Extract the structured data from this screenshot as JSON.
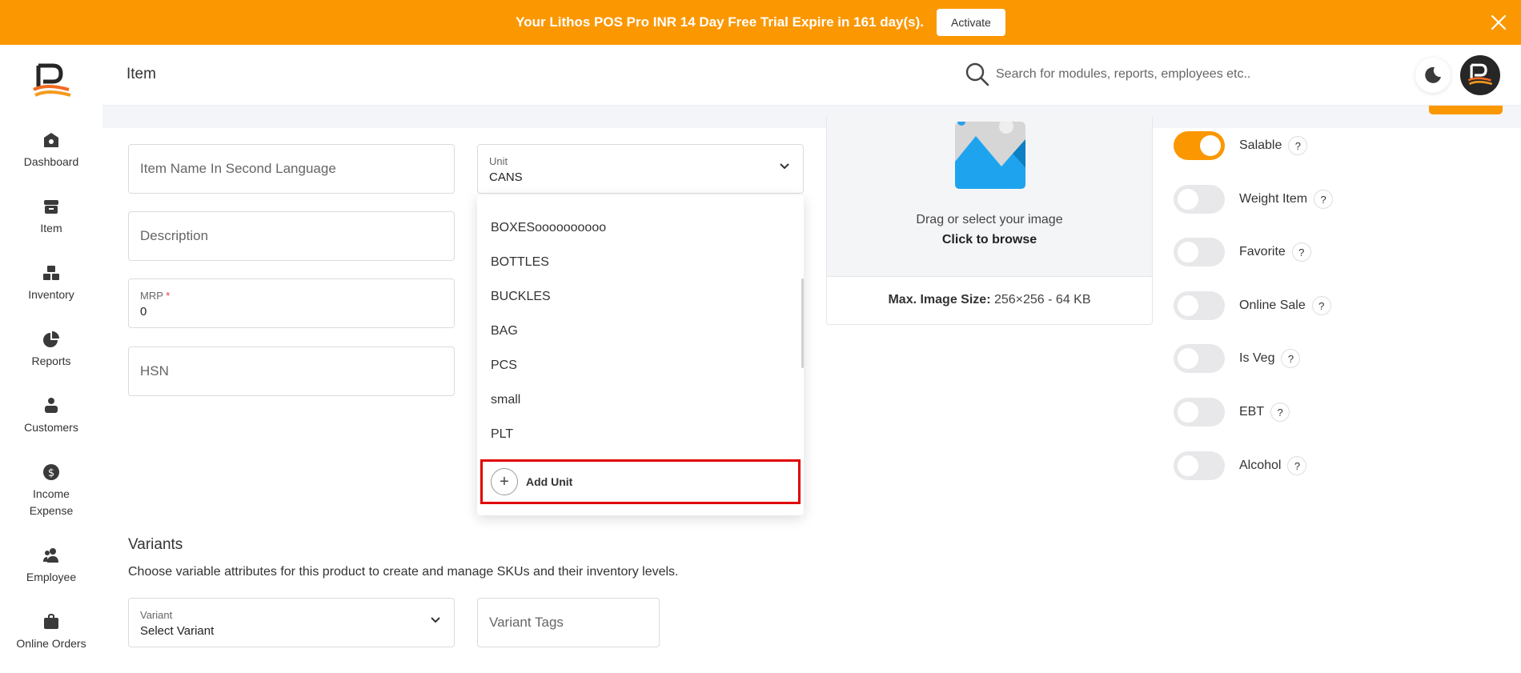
{
  "banner": {
    "text": "Your Lithos POS Pro INR 14 Day Free Trial Expire in 161 day(s).",
    "activate_label": "Activate"
  },
  "sidebar": {
    "items": [
      {
        "label": "Dashboard",
        "icon": "home-icon"
      },
      {
        "label": "Item",
        "icon": "archive-icon"
      },
      {
        "label": "Inventory",
        "icon": "boxes-icon"
      },
      {
        "label": "Reports",
        "icon": "pie-chart-icon"
      },
      {
        "label": "Customers",
        "icon": "customers-icon"
      },
      {
        "label": "Income Expense",
        "icon": "dollar-icon"
      },
      {
        "label": "Employee",
        "icon": "users-icon"
      },
      {
        "label": "Online Orders",
        "icon": "bag-icon"
      }
    ]
  },
  "header": {
    "title": "Item",
    "search_placeholder": "Search for modules, reports, employees etc.."
  },
  "form": {
    "second_language_placeholder": "Item Name In Second Language",
    "description_placeholder": "Description",
    "mrp_label": "MRP",
    "mrp_required": "*",
    "mrp_value": "0",
    "hsn_placeholder": "HSN",
    "unit_label": "Unit",
    "unit_value": "CANS"
  },
  "unit_menu": {
    "options": [
      "BOXESoooooooooo",
      "BOTTLES",
      "BUCKLES",
      "BAG",
      "PCS",
      "small",
      "PLT"
    ],
    "add_label": "Add Unit",
    "add_symbol": "+"
  },
  "upload": {
    "text": "Drag or select your image",
    "browse": "Click to browse",
    "size_label": "Max. Image Size:",
    "size_value": "256×256 - 64 KB"
  },
  "toggles": [
    {
      "label": "Salable",
      "on": true
    },
    {
      "label": "Weight Item",
      "on": false
    },
    {
      "label": "Favorite",
      "on": false
    },
    {
      "label": "Online Sale",
      "on": false
    },
    {
      "label": "Is Veg",
      "on": false
    },
    {
      "label": "EBT",
      "on": false
    },
    {
      "label": "Alcohol",
      "on": false
    }
  ],
  "help_symbol": "?",
  "variants": {
    "title": "Variants",
    "description": "Choose variable attributes for this product to create and manage SKUs and their inventory levels.",
    "variant_label": "Variant",
    "variant_value": "Select Variant",
    "tags_placeholder": "Variant Tags"
  },
  "colors": {
    "accent": "#fb9700",
    "highlight": "#e00000"
  }
}
